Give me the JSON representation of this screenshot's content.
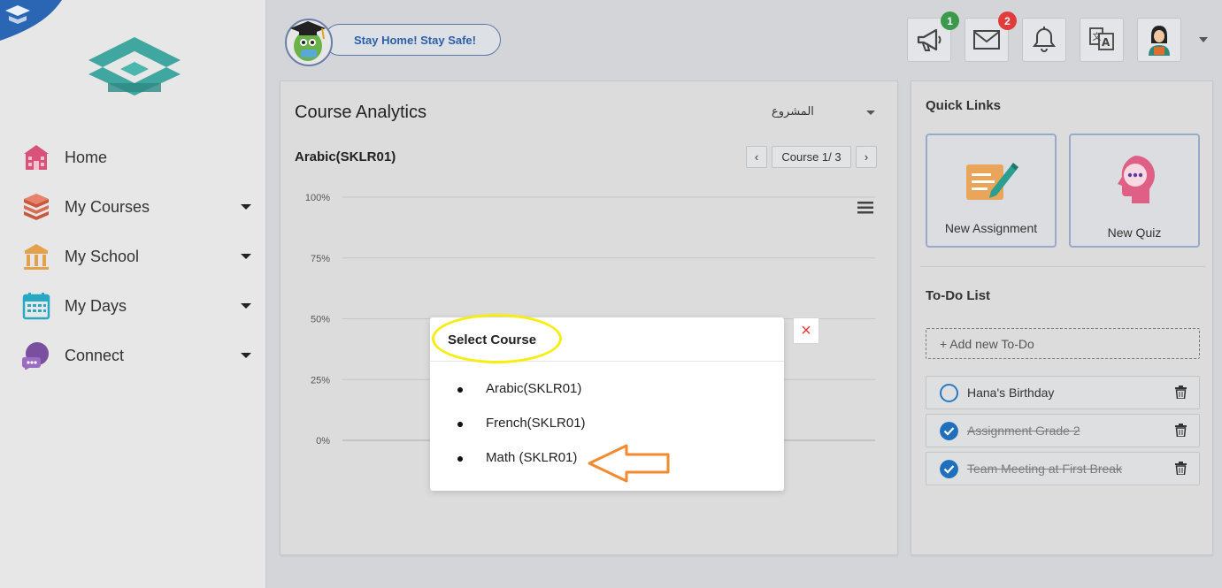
{
  "sidebar": {
    "items": [
      {
        "label": "Home",
        "icon": "school-building-icon",
        "has_dropdown": false
      },
      {
        "label": "My Courses",
        "icon": "books-icon",
        "has_dropdown": true
      },
      {
        "label": "My School",
        "icon": "columns-building-icon",
        "has_dropdown": true
      },
      {
        "label": "My Days",
        "icon": "calendar-icon",
        "has_dropdown": true
      },
      {
        "label": "Connect",
        "icon": "chat-bubbles-icon",
        "has_dropdown": true
      }
    ]
  },
  "header": {
    "banner_text": "Stay Home! Stay Safe!",
    "announcements_count": "1",
    "messages_count": "2",
    "colors": {
      "green_badge": "#3a9a4b",
      "red_badge": "#e03c3c"
    }
  },
  "analytics": {
    "title": "Course Analytics",
    "filter_value": "المشروع",
    "course_name": "Arabic(SKLR01)",
    "pager": {
      "prev": "‹",
      "label": "Course 1/ 3",
      "next": "›"
    }
  },
  "chart_data": {
    "type": "bar",
    "categories": [],
    "values": [],
    "ylim": [
      0,
      100
    ],
    "y_ticks": [
      "100%",
      "75%",
      "50%",
      "25%",
      "0%"
    ],
    "grid": true
  },
  "quick_links": {
    "title": "Quick Links",
    "items": [
      {
        "label": "New Assignment",
        "icon": "assignment-pen-icon"
      },
      {
        "label": "New Quiz",
        "icon": "quiz-head-icon"
      }
    ]
  },
  "todo": {
    "title": "To-Do List",
    "add_placeholder": "+ Add new To-Do",
    "items": [
      {
        "text": "Hana's Birthday",
        "done": false
      },
      {
        "text": "Assignment Grade 2",
        "done": true
      },
      {
        "text": "Team Meeting at First Break",
        "done": true
      }
    ]
  },
  "modal": {
    "title": "Select Course",
    "close": "×",
    "courses": [
      "Arabic(SKLR01)",
      "French(SKLR01)",
      "Math (SKLR01)"
    ]
  }
}
